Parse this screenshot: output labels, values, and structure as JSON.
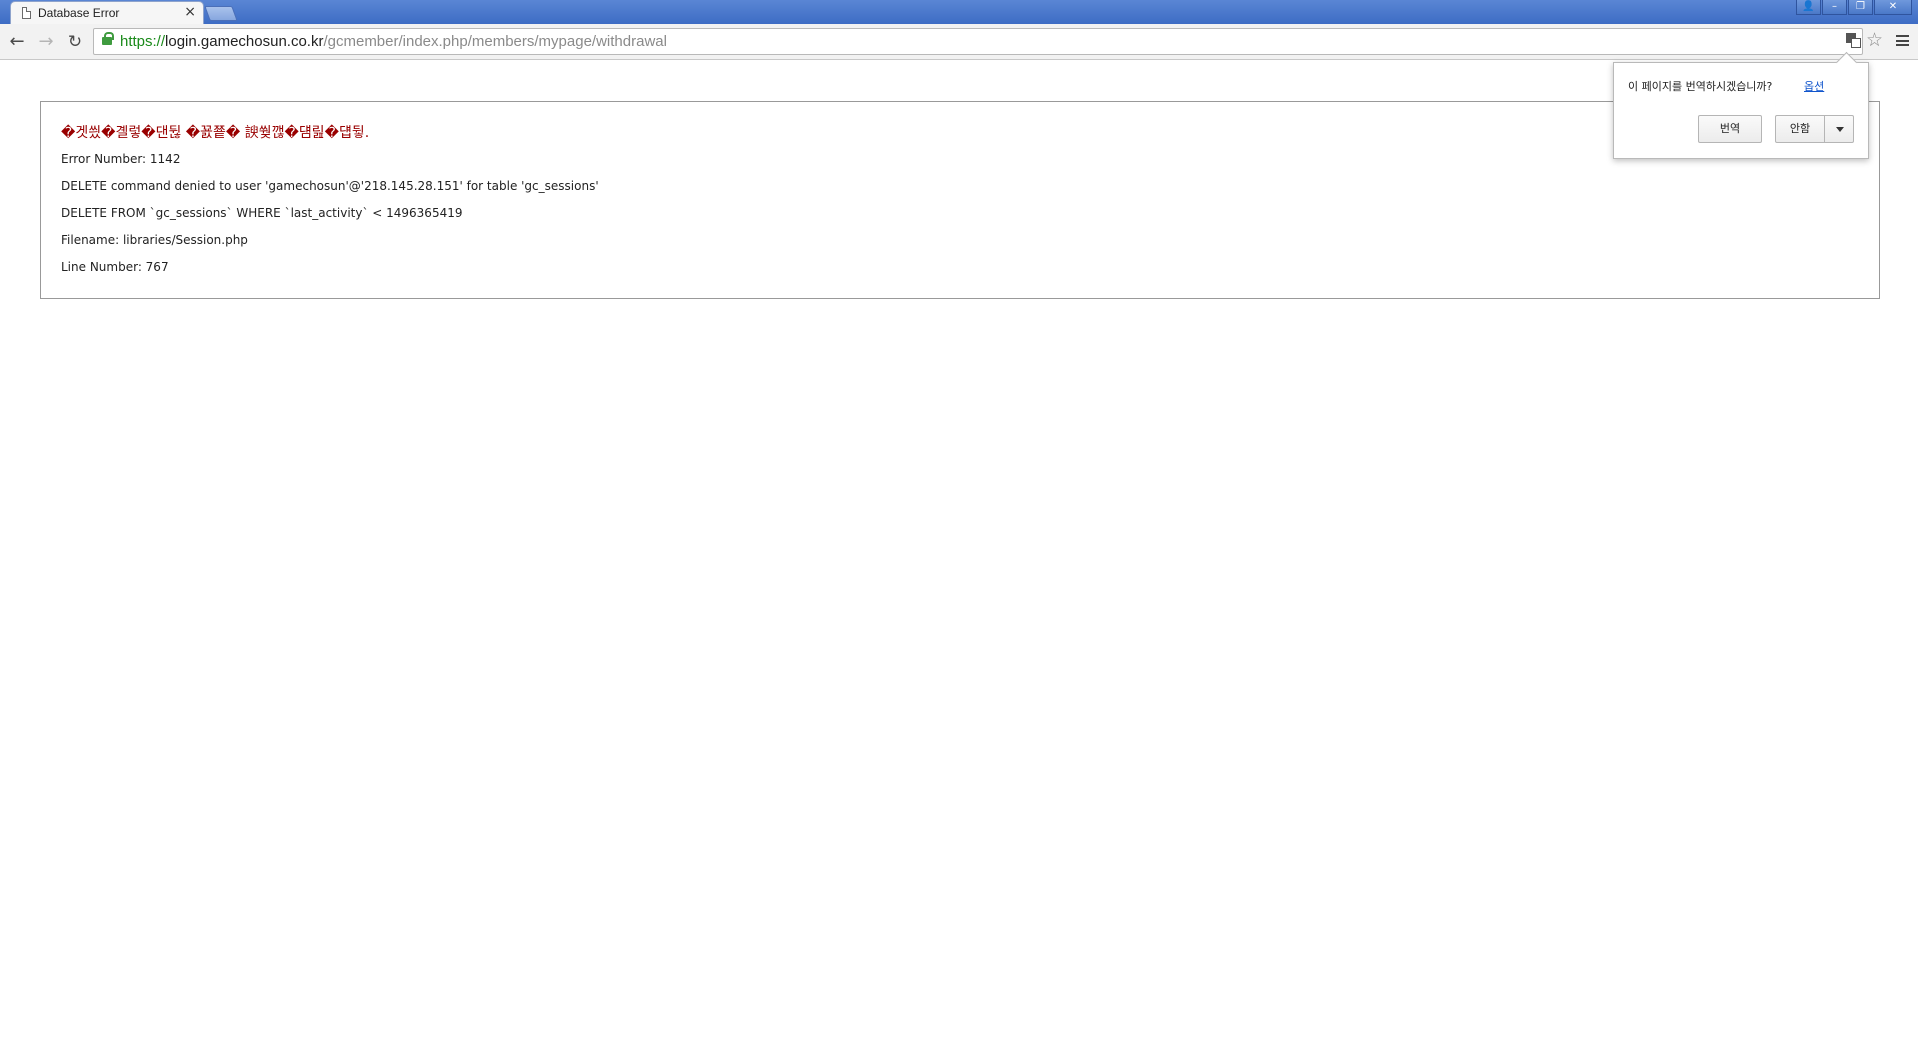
{
  "browser": {
    "tab": {
      "title": "Database Error",
      "close_glyph": "×",
      "icon": "page-icon"
    },
    "window_controls": {
      "user_glyph": "👤",
      "minimize_glyph": "–",
      "restore_glyph": "❐",
      "close_glyph": "✕"
    },
    "toolbar": {
      "back_glyph": "←",
      "forward_glyph": "→",
      "reload_glyph": "↻",
      "star_glyph": "☆"
    },
    "address": {
      "scheme": "https://",
      "host": "login.gamechosun.co.kr",
      "path": "/gcmember/index.php/members/mypage/withdrawal"
    }
  },
  "error": {
    "heading": "�겟씠�곌렇�댄뒪 �꾨쭅�  諛쒖깮�덈릺�덉뒿.",
    "error_number": "Error Number: 1142",
    "message": "DELETE command denied to user 'gamechosun'@'218.145.28.151' for table 'gc_sessions'",
    "query": "DELETE FROM `gc_sessions` WHERE `last_activity` < 1496365419",
    "filename": "Filename: libraries/Session.php",
    "line_number": "Line Number: 767",
    "heading_color": "#990000"
  },
  "translate_bubble": {
    "question": "이 페이지를 번역하시겠습니까?",
    "options_link": "옵션",
    "translate_button": "번역",
    "nope_button": "안함"
  }
}
